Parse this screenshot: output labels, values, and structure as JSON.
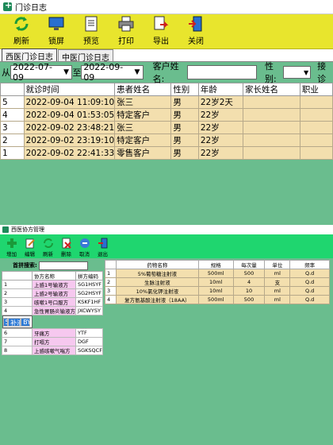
{
  "window1": {
    "title": "门诊日志",
    "toolbar": [
      "刷新",
      "锁屏",
      "预览",
      "打印",
      "导出",
      "关闭"
    ],
    "tabs": [
      "西医门诊日志",
      "中医门诊日志"
    ],
    "filter": {
      "from_label": "从",
      "from_date": "2022-07-09",
      "to_label": "至",
      "to_date": "2022-09-09",
      "name_label": "客户姓名:",
      "gender_label": "性别:",
      "extra_label": "接诊"
    },
    "columns": [
      "就诊时间",
      "患者姓名",
      "性别",
      "年龄",
      "家长姓名",
      "职业"
    ],
    "rows": [
      {
        "no": "5",
        "time": "2022-09-04 11:09:10",
        "name": "张三",
        "gender": "男",
        "age": "22岁2天",
        "parent": "",
        "job": ""
      },
      {
        "no": "4",
        "time": "2022-09-04 01:53:05",
        "name": "特定客户",
        "gender": "男",
        "age": "22岁",
        "parent": "",
        "job": ""
      },
      {
        "no": "3",
        "time": "2022-09-02 23:48:21",
        "name": "张三",
        "gender": "男",
        "age": "22岁",
        "parent": "",
        "job": ""
      },
      {
        "no": "2",
        "time": "2022-09-02 23:19:10",
        "name": "特定客户",
        "gender": "男",
        "age": "22岁",
        "parent": "",
        "job": ""
      },
      {
        "no": "1",
        "time": "2022-09-02 22:41:33",
        "name": "零售客户",
        "gender": "男",
        "age": "22岁",
        "parent": "",
        "job": ""
      }
    ]
  },
  "window2": {
    "title": "西医协方管理",
    "toolbar": [
      "增加",
      "编辑",
      "刷新",
      "删除",
      "取消",
      "退出"
    ],
    "search_label": "首拼搜索:",
    "left_columns": [
      "协方名称",
      "拼方编码"
    ],
    "left_rows": [
      {
        "no": "1",
        "name": "上感1号输液方",
        "code": "SG1HSYF",
        "style": "pink"
      },
      {
        "no": "2",
        "name": "上感2号输液方",
        "code": "SG2HSYF",
        "style": "pink"
      },
      {
        "no": "3",
        "name": "咳嗽1号口服方",
        "code": "KSKF1HF",
        "style": "pink"
      },
      {
        "no": "4",
        "name": "急性胃肠炎输液方",
        "code": "JXCWYSY",
        "style": "pink"
      },
      {
        "no": "5",
        "name": "补液方",
        "code": "BYF",
        "style": "sel"
      },
      {
        "no": "6",
        "name": "牙痛方",
        "code": "YTF",
        "style": "pink"
      },
      {
        "no": "7",
        "name": "打嗝方",
        "code": "DGF",
        "style": "pink"
      },
      {
        "no": "8",
        "name": "上感咳嗽气喘方",
        "code": "SGKSQCF",
        "style": "pink"
      }
    ],
    "right_columns": [
      "药物名称",
      "规格",
      "每次量",
      "单位",
      "频率"
    ],
    "right_rows": [
      {
        "no": "1",
        "drug": "5%葡萄糖注射液",
        "spec": "500ml",
        "qty": "500",
        "unit": "ml",
        "freq": "Q.d"
      },
      {
        "no": "2",
        "drug": "生脉注射液",
        "spec": "10ml",
        "qty": "4",
        "unit": "支",
        "freq": "Q.d"
      },
      {
        "no": "3",
        "drug": "10%氯化钾注射液",
        "spec": "10ml",
        "qty": "10",
        "unit": "ml",
        "freq": "Q.d"
      },
      {
        "no": "4",
        "drug": "复方氨基酸注射液（18AA）",
        "spec": "500ml",
        "qty": "500",
        "unit": "ml",
        "freq": "Q.d"
      }
    ]
  }
}
